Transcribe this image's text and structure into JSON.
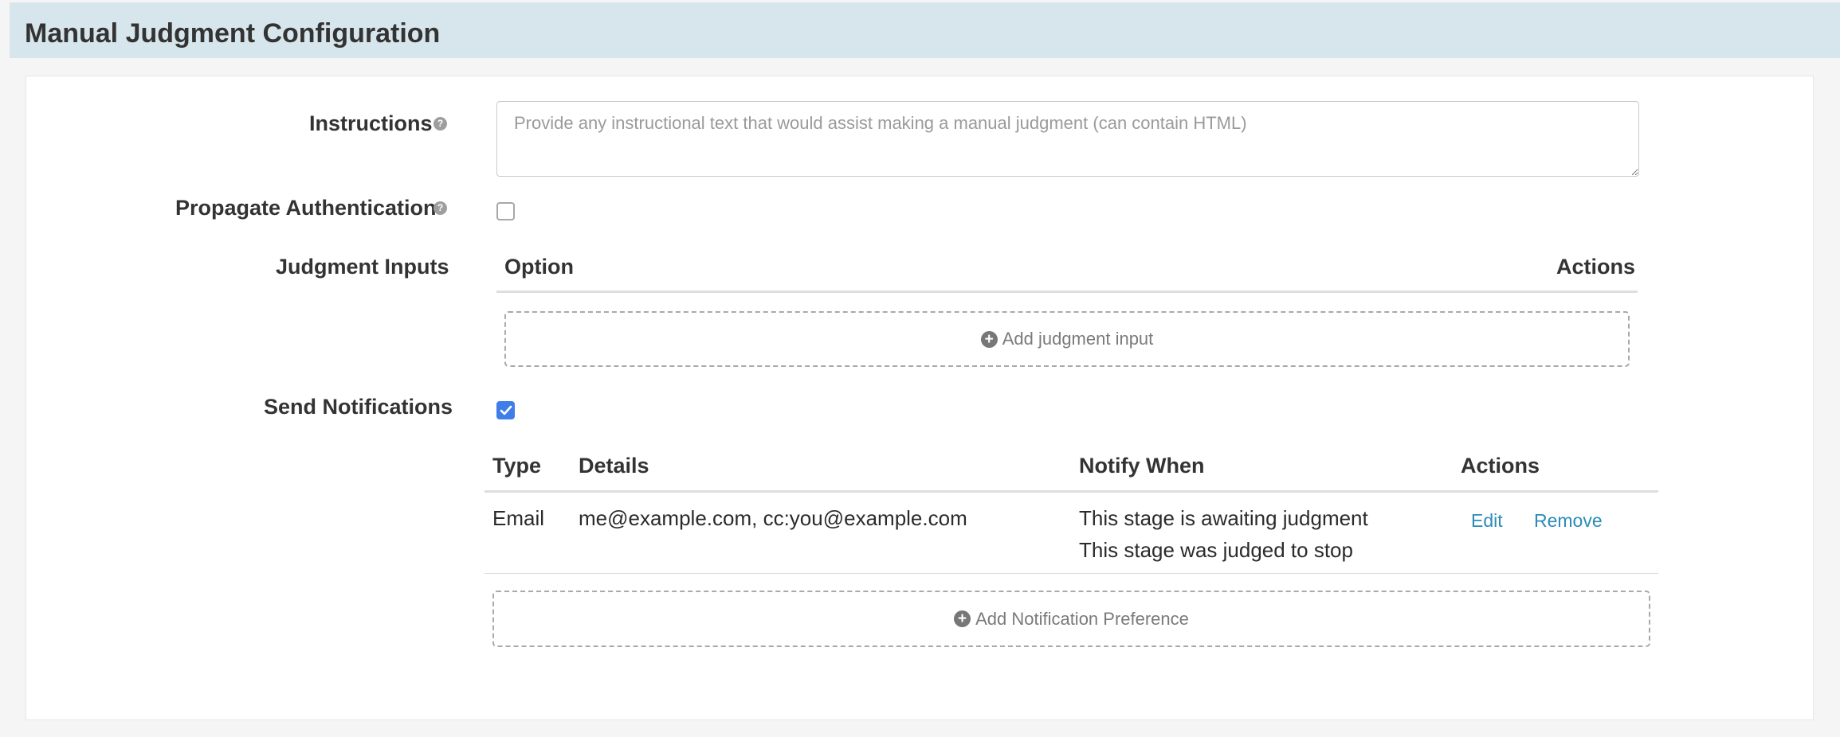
{
  "header": {
    "title": "Manual Judgment Configuration"
  },
  "instructions": {
    "label": "Instructions",
    "placeholder": "Provide any instructional text that would assist making a manual judgment (can contain HTML)",
    "value": ""
  },
  "propagate_authentication": {
    "label": "Propagate Authentication",
    "checked": false
  },
  "judgment_inputs": {
    "label": "Judgment Inputs",
    "columns": [
      "Option",
      "Actions"
    ],
    "add_button_label": "Add judgment input"
  },
  "send_notifications": {
    "label": "Send Notifications",
    "checked": true,
    "columns": [
      "Type",
      "Details",
      "Notify When",
      "Actions"
    ],
    "rows": [
      {
        "type": "Email",
        "details": "me@example.com, cc:you@example.com",
        "notify_when": [
          "This stage is awaiting judgment",
          "This stage was judged to stop"
        ],
        "edit_label": "Edit",
        "remove_label": "Remove"
      }
    ],
    "add_button_label": "Add Notification Preference"
  },
  "icons": {
    "help": "help-circle-icon",
    "add": "plus-circle-icon",
    "check": "check-icon"
  },
  "colors": {
    "header_bg": "#d7e6ec",
    "checkbox_checked": "#3f7ee8",
    "link": "#2b8cb8"
  }
}
